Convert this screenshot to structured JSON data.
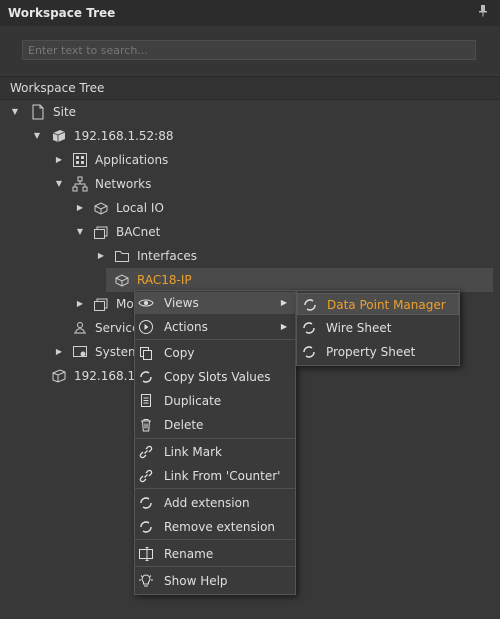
{
  "panel": {
    "title": "Workspace Tree"
  },
  "search": {
    "placeholder": "Enter text to search..."
  },
  "tree": {
    "header": "Workspace Tree",
    "nodes": [
      {
        "label": "Site",
        "icon": "page-icon"
      },
      {
        "label": "192.168.1.52:88",
        "icon": "station-icon"
      },
      {
        "label": "Applications",
        "icon": "grid-icon"
      },
      {
        "label": "Networks",
        "icon": "network-icon"
      },
      {
        "label": "Local IO",
        "icon": "device-icon"
      },
      {
        "label": "BACnet",
        "icon": "folder-device-icon"
      },
      {
        "label": "Interfaces",
        "icon": "folder-icon"
      },
      {
        "label": "RAC18-IP",
        "icon": "device-icon"
      },
      {
        "label": "Mo",
        "icon": "folder-device-icon"
      },
      {
        "label": "Service",
        "icon": "service-icon"
      },
      {
        "label": "System",
        "icon": "system-icon"
      },
      {
        "label": "192.168.1.5",
        "icon": "station-icon"
      }
    ]
  },
  "context_menu": {
    "items": [
      {
        "label": "Views",
        "icon": "eye-icon"
      },
      {
        "label": "Actions",
        "icon": "play-icon"
      },
      {
        "label": "Copy",
        "icon": "copy-icon"
      },
      {
        "label": "Copy Slots Values",
        "icon": "spinner-icon"
      },
      {
        "label": "Duplicate",
        "icon": "duplicate-icon"
      },
      {
        "label": "Delete",
        "icon": "trash-icon"
      },
      {
        "label": "Link Mark",
        "icon": "link-icon"
      },
      {
        "label": "Link From 'Counter'",
        "icon": "link-icon"
      },
      {
        "label": "Add extension",
        "icon": "spinner-icon"
      },
      {
        "label": "Remove extension",
        "icon": "spinner-icon"
      },
      {
        "label": "Rename",
        "icon": "rename-icon"
      },
      {
        "label": "Show Help",
        "icon": "bulb-icon"
      }
    ]
  },
  "submenu": {
    "items": [
      {
        "label": "Data Point Manager",
        "icon": "spinner-icon"
      },
      {
        "label": "Wire Sheet",
        "icon": "spinner-icon"
      },
      {
        "label": "Property Sheet",
        "icon": "spinner-icon"
      }
    ]
  },
  "colors": {
    "accent": "#f0a02a",
    "background": "#383838",
    "menu_bg": "#3a3a3a"
  }
}
